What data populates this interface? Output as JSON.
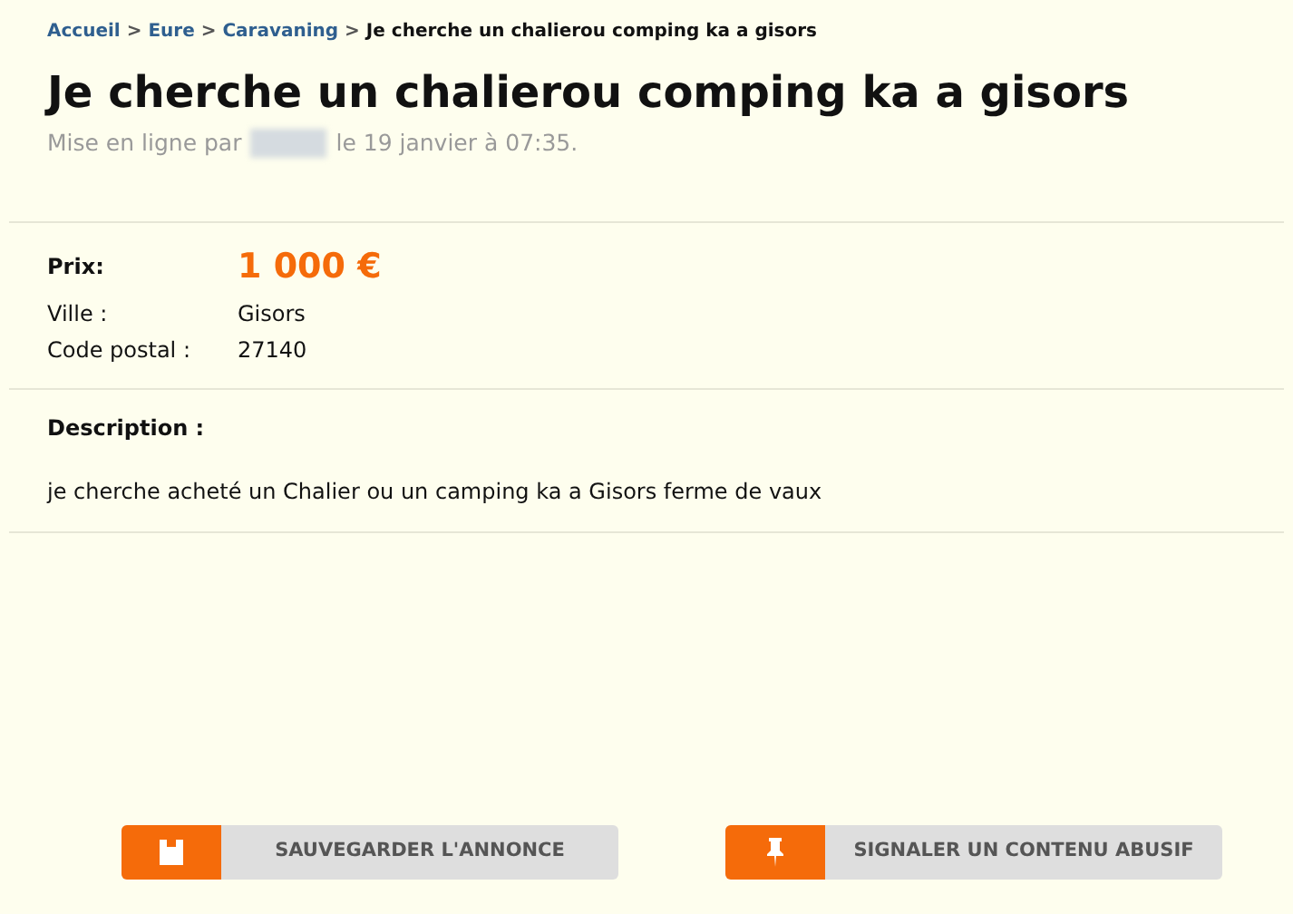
{
  "breadcrumb": [
    {
      "label": "Accueil",
      "kind": "link"
    },
    {
      "label": "Eure",
      "kind": "link"
    },
    {
      "label": "Caravaning",
      "kind": "link"
    },
    {
      "label": "Je cherche un chalierou comping ka a gisors",
      "kind": "current"
    }
  ],
  "breadcrumb_separator": ">",
  "title": "Je cherche un chalierou comping ka a gisors",
  "meta": {
    "prefix": "Mise en ligne par",
    "date": "le 19 janvier à 07:35."
  },
  "price": {
    "label": "Prix:",
    "value": "1 000 €"
  },
  "fields": [
    {
      "label": "Ville :",
      "value": "Gisors"
    },
    {
      "label": "Code postal :",
      "value": "27140"
    }
  ],
  "description": {
    "heading": "Description :",
    "text": "je cherche acheté un Chalier ou un camping ka a Gisors ferme de vaux"
  },
  "buttons": [
    {
      "label": "SAUVEGARDER L'ANNONCE",
      "kind": "save"
    },
    {
      "label": "SIGNALER UN CONTENU ABUSIF",
      "kind": "report"
    }
  ]
}
